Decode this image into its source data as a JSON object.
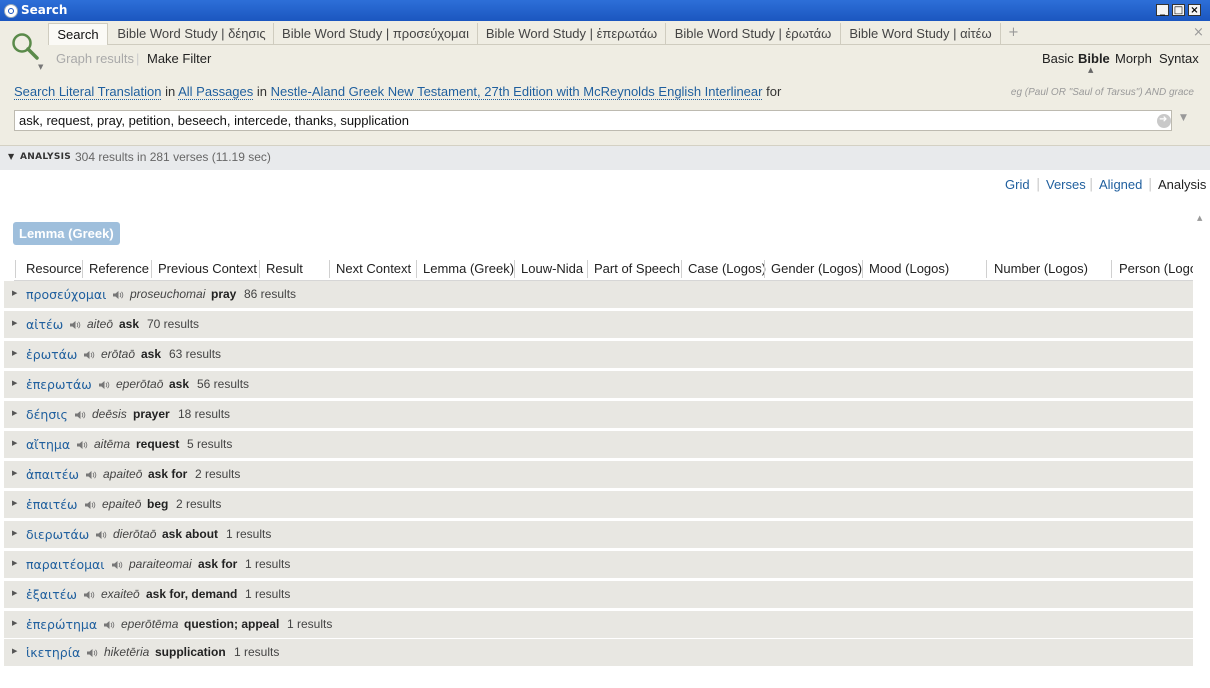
{
  "window": {
    "title": "Search"
  },
  "tabs": [
    {
      "label": "Search",
      "active": true
    },
    {
      "label": "Bible Word Study | δέησις"
    },
    {
      "label": "Bible Word Study | προσεύχομαι"
    },
    {
      "label": "Bible Word Study | ἐπερωτάω"
    },
    {
      "label": "Bible Word Study | ἐρωτάω"
    },
    {
      "label": "Bible Word Study | αἰτέω"
    }
  ],
  "tab_add": "+",
  "tab_close": "×",
  "toolbar": {
    "graph_results": "Graph results",
    "separator": "|",
    "make_filter": "Make Filter"
  },
  "modes": [
    "Basic",
    "Bible",
    "Morph",
    "Syntax"
  ],
  "criteria": {
    "search": "Search",
    "field": "Literal Translation",
    "in1": "in",
    "range": "All Passages",
    "in2": "in",
    "resource": "Nestle-Aland Greek New Testament, 27th Edition with McReynolds English Interlinear",
    "for": "for"
  },
  "hint": "eg (Paul OR \"Saul of Tarsus\") AND grace",
  "search_query": "ask, request, pray, petition, beseech, intercede, thanks, supplication",
  "analysis": {
    "label": "ANALYSIS",
    "summary": "304 results in 281 verses (11.19 sec)"
  },
  "views": [
    "Grid",
    "Verses",
    "Aligned",
    "Analysis"
  ],
  "group_chip": "Lemma (Greek)",
  "columns": [
    "Resource",
    "Reference",
    "Previous Context",
    "Result",
    "Next Context",
    "Lemma (Greek)",
    "Louw-Nida",
    "Part of Speech",
    "Case (Logos)",
    "Gender (Logos)",
    "Mood (Logos)",
    "Number (Logos)",
    "Person (Logos)"
  ],
  "rows": [
    {
      "lemma": "προσεύχομαι",
      "translit": "proseuchomai",
      "gloss": "pray",
      "count": "86 results"
    },
    {
      "lemma": "αἰτέω",
      "translit": "aiteō",
      "gloss": "ask",
      "count": "70 results"
    },
    {
      "lemma": "ἐρωτάω",
      "translit": "erōtaō",
      "gloss": "ask",
      "count": "63 results"
    },
    {
      "lemma": "ἐπερωτάω",
      "translit": "eperōtaō",
      "gloss": "ask",
      "count": "56 results"
    },
    {
      "lemma": "δέησις",
      "translit": "deēsis",
      "gloss": "prayer",
      "count": "18 results"
    },
    {
      "lemma": "αἴτημα",
      "translit": "aitēma",
      "gloss": "request",
      "count": "5 results"
    },
    {
      "lemma": "ἀπαιτέω",
      "translit": "apaiteō",
      "gloss": "ask for",
      "count": "2 results"
    },
    {
      "lemma": "ἐπαιτέω",
      "translit": "epaiteō",
      "gloss": "beg",
      "count": "2 results"
    },
    {
      "lemma": "διερωτάω",
      "translit": "dierōtaō",
      "gloss": "ask about",
      "count": "1 results"
    },
    {
      "lemma": "παραιτέομαι",
      "translit": "paraiteomai",
      "gloss": "ask for",
      "count": "1 results"
    },
    {
      "lemma": "ἐξαιτέω",
      "translit": "exaiteō",
      "gloss": "ask for, demand",
      "count": "1 results"
    },
    {
      "lemma": "ἐπερώτημα",
      "translit": "eperōtēma",
      "gloss": "question; appeal",
      "count": "1 results"
    },
    {
      "lemma": "ἱκετηρία",
      "translit": "hiketēria",
      "gloss": "supplication",
      "count": "1 results"
    }
  ],
  "colors": {
    "link": "#1f5f9e",
    "titlebar": "#1b56bf",
    "chip": "#9fbfdc",
    "row_bg": "#e8e7e2",
    "toolbar_bg": "#efede3"
  }
}
